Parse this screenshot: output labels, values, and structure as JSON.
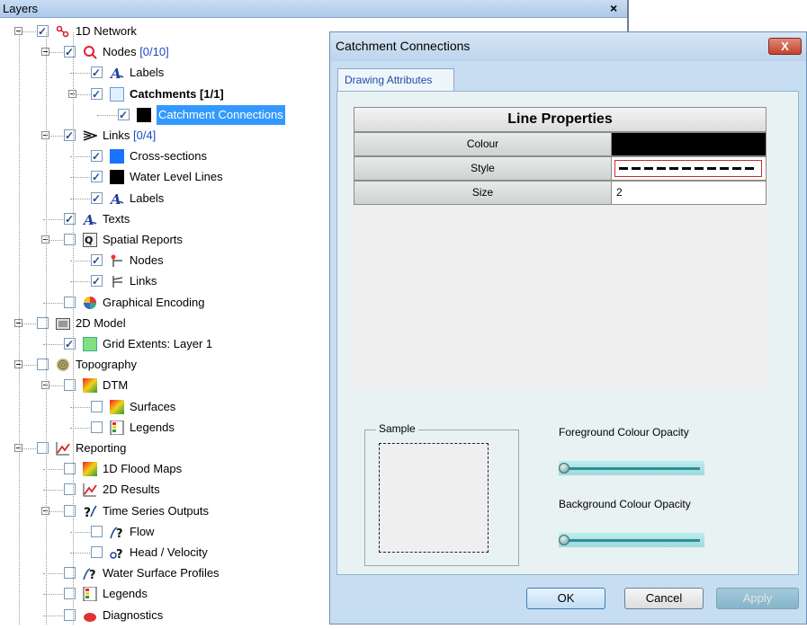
{
  "layers_panel": {
    "title": "Layers",
    "close_glyph": "×",
    "tree": [
      {
        "label": "1D Network",
        "indent": 0,
        "checked": true,
        "expander": true,
        "icon": "network-icon"
      },
      {
        "label": "Nodes",
        "count": "[0/10]",
        "indent": 1,
        "checked": true,
        "expander": true,
        "icon": "nodes-icon"
      },
      {
        "label": "Labels",
        "indent": 2,
        "checked": true,
        "expander": false,
        "icon": "labels-icon"
      },
      {
        "label": "Catchments [1/1]",
        "indent": 2,
        "checked": true,
        "expander": true,
        "icon": "catchment-swatch-icon",
        "bold": true
      },
      {
        "label": "Catchment Connections",
        "indent": 3,
        "checked": true,
        "expander": false,
        "icon": "black-swatch-icon",
        "selected": true
      },
      {
        "label": "Links",
        "count": "[0/4]",
        "indent": 1,
        "checked": true,
        "expander": true,
        "icon": "links-icon"
      },
      {
        "label": "Cross-sections",
        "indent": 2,
        "checked": true,
        "expander": false,
        "icon": "blue-swatch-icon"
      },
      {
        "label": "Water Level Lines",
        "indent": 2,
        "checked": true,
        "expander": false,
        "icon": "black-swatch-icon"
      },
      {
        "label": "Labels",
        "indent": 2,
        "checked": true,
        "expander": false,
        "icon": "labels-icon"
      },
      {
        "label": "Texts",
        "indent": 1,
        "checked": true,
        "expander": false,
        "icon": "labels-icon"
      },
      {
        "label": "Spatial Reports",
        "indent": 1,
        "checked": false,
        "expander": true,
        "icon": "spatial-reports-icon"
      },
      {
        "label": "Nodes",
        "indent": 2,
        "checked": true,
        "expander": false,
        "icon": "node-report-icon"
      },
      {
        "label": "Links",
        "indent": 2,
        "checked": true,
        "expander": false,
        "icon": "link-report-icon"
      },
      {
        "label": "Graphical Encoding",
        "indent": 1,
        "checked": false,
        "expander": false,
        "icon": "color-wheel-icon"
      },
      {
        "label": "2D Model",
        "indent": 0,
        "checked": false,
        "expander": true,
        "icon": "model-2d-icon"
      },
      {
        "label": "Grid Extents: Layer 1",
        "indent": 1,
        "checked": true,
        "expander": false,
        "icon": "green-swatch-icon"
      },
      {
        "label": "Topography",
        "indent": 0,
        "checked": false,
        "expander": true,
        "icon": "topography-icon"
      },
      {
        "label": "DTM",
        "indent": 1,
        "checked": false,
        "expander": true,
        "icon": "dtm-icon"
      },
      {
        "label": "Surfaces",
        "indent": 2,
        "checked": false,
        "expander": false,
        "icon": "surfaces-icon"
      },
      {
        "label": "Legends",
        "indent": 2,
        "checked": false,
        "expander": false,
        "icon": "legend-icon"
      },
      {
        "label": "Reporting",
        "indent": 0,
        "checked": false,
        "expander": true,
        "icon": "chart-line-icon"
      },
      {
        "label": "1D Flood Maps",
        "indent": 1,
        "checked": false,
        "expander": false,
        "icon": "flood-map-icon"
      },
      {
        "label": "2D Results",
        "indent": 1,
        "checked": false,
        "expander": false,
        "icon": "chart-line-icon"
      },
      {
        "label": "Time Series Outputs",
        "indent": 1,
        "checked": false,
        "expander": true,
        "icon": "timeseries-icon"
      },
      {
        "label": "Flow",
        "indent": 2,
        "checked": false,
        "expander": false,
        "icon": "flow-icon"
      },
      {
        "label": "Head / Velocity",
        "indent": 2,
        "checked": false,
        "expander": false,
        "icon": "head-velocity-icon"
      },
      {
        "label": "Water Surface Profiles",
        "indent": 1,
        "checked": false,
        "expander": false,
        "icon": "flow-icon"
      },
      {
        "label": "Legends",
        "indent": 1,
        "checked": false,
        "expander": false,
        "icon": "legend-icon"
      },
      {
        "label": "Diagnostics",
        "indent": 1,
        "checked": false,
        "expander": false,
        "icon": "diagnostics-icon"
      }
    ]
  },
  "dialog": {
    "title": "Catchment Connections",
    "close_glyph": "X",
    "tabs": [
      {
        "label": "Drawing Attributes"
      }
    ],
    "line_properties": {
      "header": "Line Properties",
      "rows": [
        {
          "label": "Colour",
          "value": ""
        },
        {
          "label": "Style",
          "value": ""
        },
        {
          "label": "Size",
          "value": "2"
        }
      ]
    },
    "sample_label": "Sample",
    "foreground_opacity_label": "Foreground Colour Opacity",
    "background_opacity_label": "Background Colour Opacity",
    "foreground_opacity": 0,
    "background_opacity": 0,
    "buttons": {
      "ok": "OK",
      "cancel": "Cancel",
      "apply": "Apply"
    }
  },
  "colors": {
    "selection": "#3399ff",
    "count_text": "#1b49c7",
    "colour_swatch": "#000000",
    "catchment_swatch": "#e0f0ff",
    "blue_swatch": "#1a73ff",
    "green_swatch": "#80e080"
  }
}
